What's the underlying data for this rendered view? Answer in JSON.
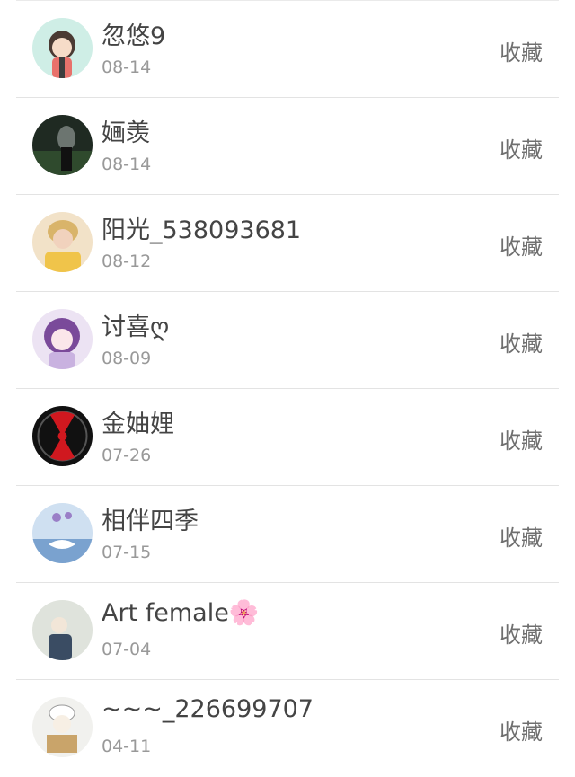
{
  "favorite_label": "收藏",
  "items": [
    {
      "name": "忽悠9",
      "date": "08-14",
      "avatar": "cartoon-girl-avatar"
    },
    {
      "name": "婳羡",
      "date": "08-14",
      "avatar": "dark-photo-avatar"
    },
    {
      "name": "阳光_538093681",
      "date": "08-12",
      "avatar": "blonde-person-avatar"
    },
    {
      "name": "讨喜ღ",
      "date": "08-09",
      "avatar": "anime-girl-avatar"
    },
    {
      "name": "金妯娌",
      "date": "07-26",
      "avatar": "exo-logo-avatar"
    },
    {
      "name": "相伴四季",
      "date": "07-15",
      "avatar": "swan-avatar"
    },
    {
      "name": "Art female",
      "date": "07-04",
      "avatar": "girl-photo-avatar",
      "flower": "🌸"
    },
    {
      "name": "~~~_226699707",
      "date": "04-11",
      "avatar": "cartoon-box-avatar"
    }
  ]
}
